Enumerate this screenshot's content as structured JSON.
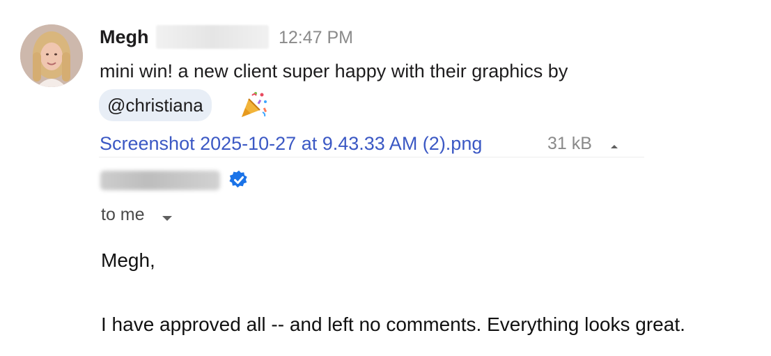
{
  "message": {
    "author": "Megh",
    "time": "12:47 PM",
    "text": "mini win! a new client super happy with their graphics by",
    "mention": "@christiana",
    "emoji": "party-popper-icon"
  },
  "attachment": {
    "filename": "Screenshot 2025-10-27 at 9.43.33 AM (2).png",
    "size": "31 kB"
  },
  "email": {
    "recipients": "to me",
    "salutation": "Megh,",
    "body": "I have approved all -- and left no comments. Everything looks great."
  },
  "colors": {
    "link": "#3b58c4",
    "mention_bg": "#e8eef6",
    "verified": "#1a73e8",
    "timestamp": "#8a8a8a"
  }
}
